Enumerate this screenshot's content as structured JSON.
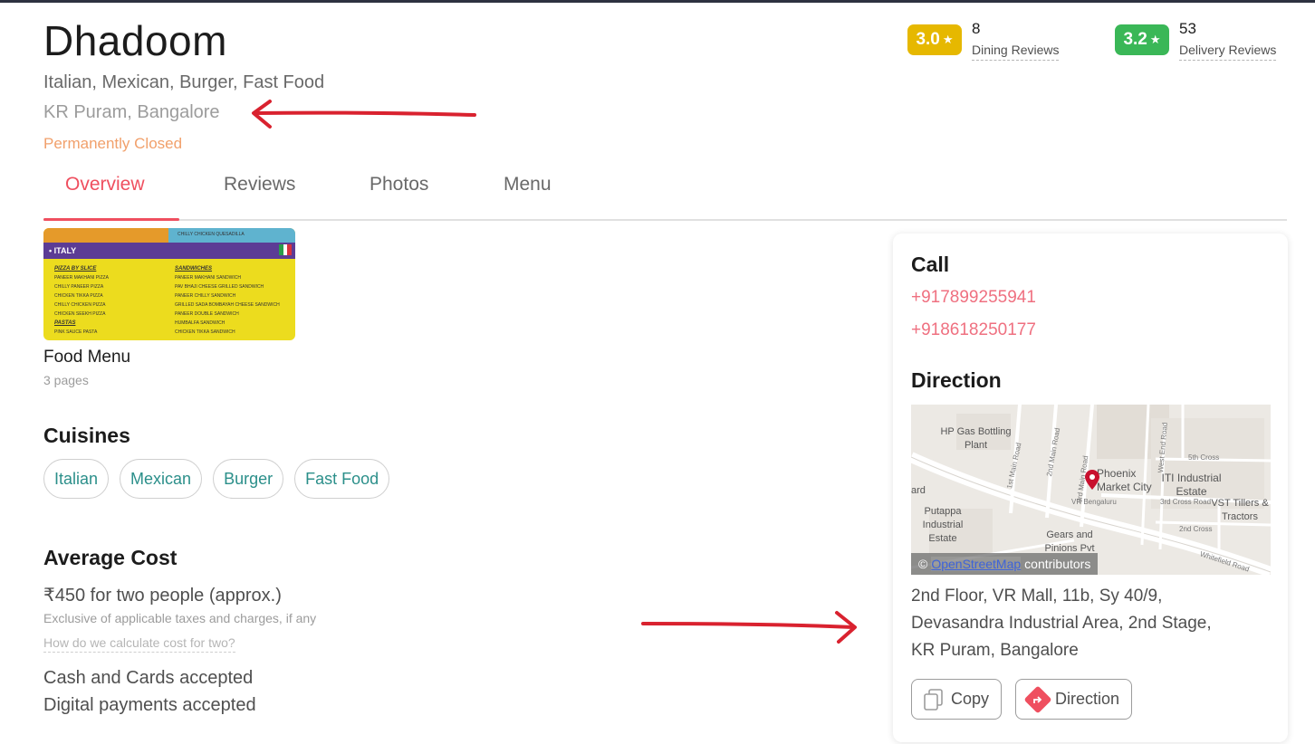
{
  "restaurant": {
    "name": "Dhadoom",
    "cuisines_line": "Italian, Mexican, Burger, Fast Food",
    "location": "KR Puram, Bangalore",
    "status": "Permanently Closed"
  },
  "ratings": [
    {
      "value": "3.0",
      "count": "8",
      "label": "Dining Reviews",
      "color": "#e6b800"
    },
    {
      "value": "3.2",
      "count": "53",
      "label": "Delivery Reviews",
      "color": "#3ab757"
    }
  ],
  "tabs": [
    "Overview",
    "Reviews",
    "Photos",
    "Menu"
  ],
  "menu": {
    "title": "Food Menu",
    "pages": "3 pages",
    "thumb": {
      "band": "ITALY",
      "top_item": "CHILLY CHICKEN QUESADILLA",
      "col1_heading": "PIZZA BY SLICE",
      "col1_items": [
        "PANEER MAKHANI PIZZA",
        "CHILLY PANEER PIZZA",
        "CHICKEN TIKKA PIZZA",
        "CHILLY CHICKEN PIZZA",
        "CHICKEN SEEKH PIZZA"
      ],
      "col1_heading2": "PASTAS",
      "col1_item2": "PINK SAUCE PASTA",
      "col2_heading": "SANDWICHES",
      "col2_items": [
        "PANEER MAKHANI SANDWICH",
        "PAV BHAJI CHEESE GRILLED SANDWICH",
        "PANEER CHILLY SANDWICH",
        "GRILLED SADA BOMBAYAH CHEESE SANDWICH",
        "PANEER DOUBLE SANDWICH",
        "HUMBALFA SANDWICH",
        "CHICKEN TIKKA SANDWICH"
      ]
    }
  },
  "cuisines": {
    "heading": "Cuisines",
    "items": [
      "Italian",
      "Mexican",
      "Burger",
      "Fast Food"
    ]
  },
  "cost": {
    "heading": "Average Cost",
    "value": "₹450 for two people (approx.)",
    "note": "Exclusive of applicable taxes and charges, if any",
    "link": "How do we calculate cost for two?",
    "payment1": "Cash and Cards accepted",
    "payment2": "Digital payments accepted"
  },
  "contact": {
    "call_heading": "Call",
    "phones": [
      "+917899255941",
      "+918618250177"
    ],
    "direction_heading": "Direction",
    "address_lines": [
      "2nd Floor, VR Mall, 11b, Sy 40/9,",
      "Devasandra Industrial Area, 2nd Stage,",
      "KR Puram, Bangalore"
    ],
    "copy_label": "Copy",
    "direction_label": "Direction"
  },
  "map": {
    "labels": {
      "hp_gas": "HP Gas Bottling Plant",
      "phoenix": "Phoenix Market City",
      "iti": "ITI Industrial Estate",
      "putappa": "Putappa Industrial Estate",
      "gears": "Gears and Pinions Pvt",
      "vst": "VST Tillers & Tractors",
      "ard": "ard",
      "vr": "VR Bengaluru",
      "main1": "1st Main Road",
      "main2": "2nd Main Road",
      "main3": "3rd Main Road",
      "west_end": "West End Road",
      "cross5": "5th Cross",
      "cross3": "3rd Cross Road",
      "cross2": "2nd Cross",
      "whitefield": "Whitefield Road"
    },
    "attribution_link": "OpenStreetMap",
    "attribution_suffix": "contributors",
    "pin_color": "#c8102e"
  },
  "colors": {
    "accent": "#ef4f5f",
    "arrow": "#d9222f"
  }
}
